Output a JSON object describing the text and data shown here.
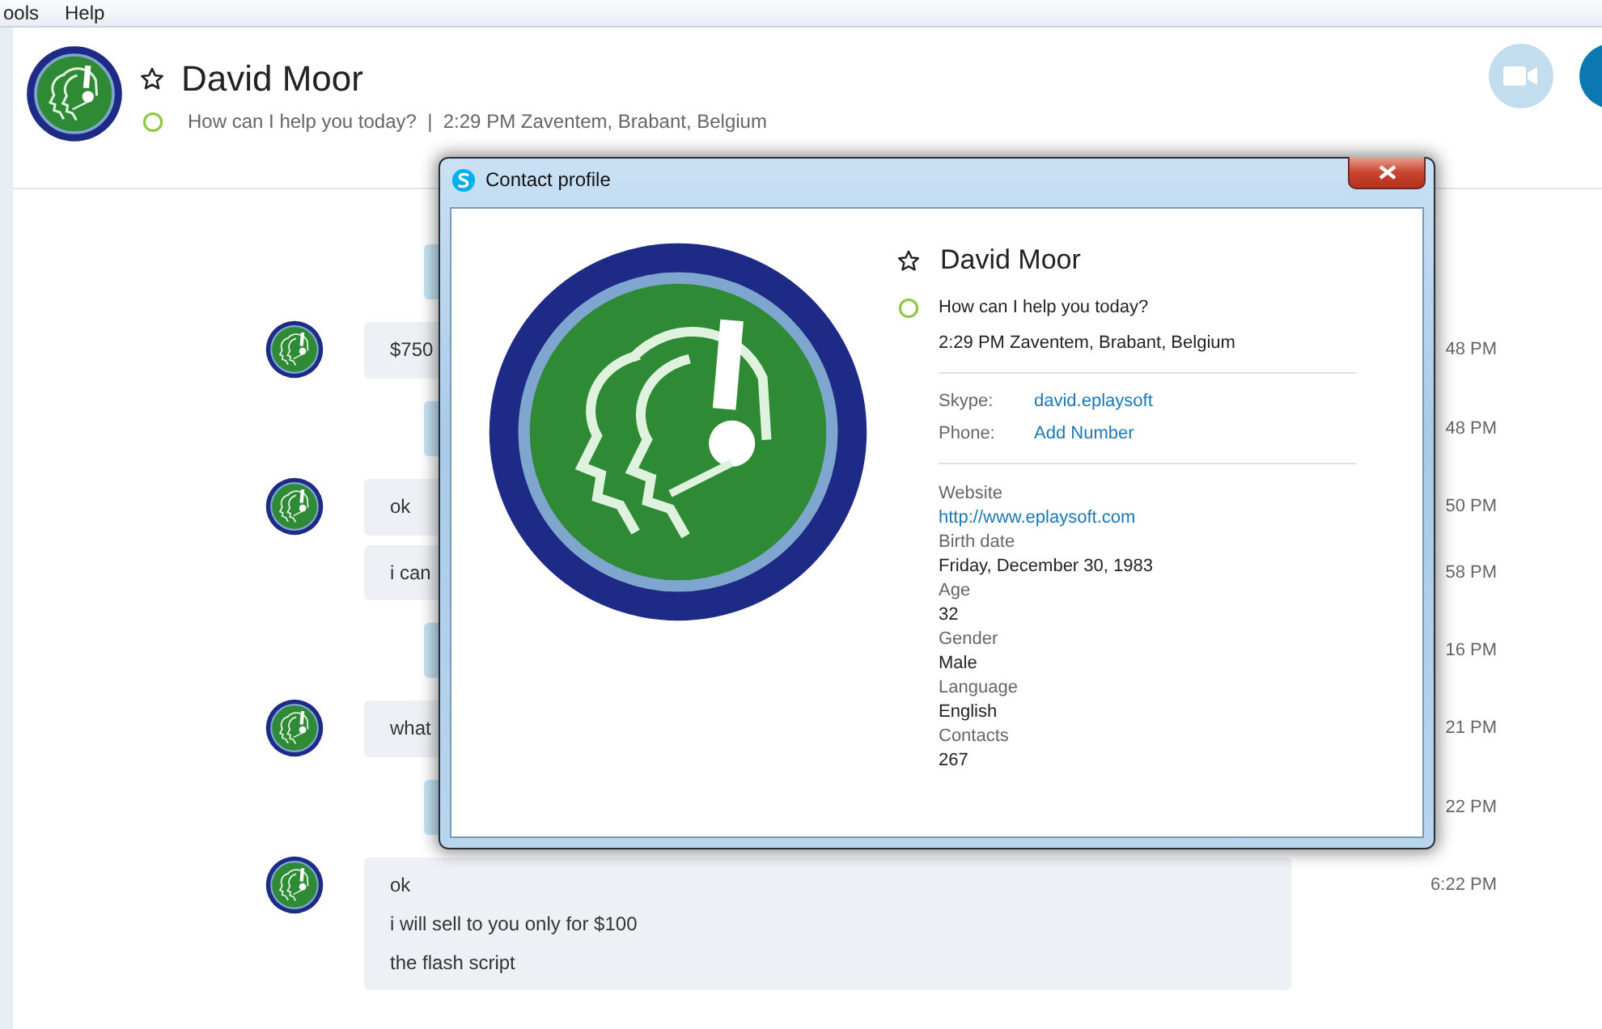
{
  "menu": [
    {
      "label": "ools"
    },
    {
      "label": "Help"
    }
  ],
  "header": {
    "name": "David Moor",
    "favorite": false,
    "online": true,
    "status_line": "How can I help you today?  |  2:29 PM Zaventem, Brabant, Belgium"
  },
  "messages": [
    {
      "kind": "sent"
    },
    {
      "kind": "received",
      "lines": [
        "$750"
      ],
      "time": "48 PM"
    },
    {
      "kind": "sent",
      "time": "48 PM"
    },
    {
      "kind": "received",
      "lines": [
        "ok"
      ],
      "time": "50 PM"
    },
    {
      "kind": "continued",
      "lines": [
        "i can"
      ],
      "time": "58 PM"
    },
    {
      "kind": "sent",
      "time": "16 PM"
    },
    {
      "kind": "received",
      "lines": [
        "what"
      ],
      "time": "21 PM"
    },
    {
      "kind": "sent",
      "time": "22 PM"
    },
    {
      "kind": "received",
      "lines": [
        "ok",
        "i will sell to you only for $100",
        "the flash script"
      ],
      "time": "6:22 PM"
    }
  ],
  "dialog": {
    "title": "Contact profile",
    "name": "David Moor",
    "favorite": false,
    "online": true,
    "mood": "How can I help you today?",
    "location": "2:29 PM Zaventem, Brabant, Belgium",
    "accounts": [
      {
        "label": "Skype:",
        "value": "david.eplaysoft",
        "link": true
      },
      {
        "label": "Phone:",
        "value": "Add Number",
        "link": true
      }
    ],
    "details": [
      {
        "label": "Website",
        "value": "http://www.eplaysoft.com",
        "link": true
      },
      {
        "label": "Birth date",
        "value": "Friday, December 30, 1983",
        "link": false
      },
      {
        "label": "Age",
        "value": "32",
        "link": false
      },
      {
        "label": "Gender",
        "value": "Male",
        "link": false
      },
      {
        "label": "Language",
        "value": "English",
        "link": false
      },
      {
        "label": "Contacts",
        "value": "267",
        "link": false
      }
    ]
  }
}
